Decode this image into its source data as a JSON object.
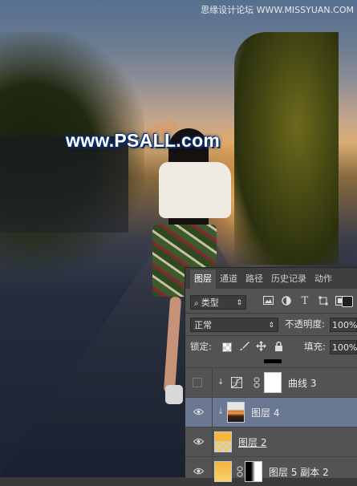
{
  "watermarks": {
    "top": "思缘设计论坛 WWW.MISSYUAN.COM",
    "main": "www.PSALL.com"
  },
  "layers_panel": {
    "tabs": [
      {
        "label": "图层",
        "active": true
      },
      {
        "label": "通道",
        "active": false
      },
      {
        "label": "路径",
        "active": false
      },
      {
        "label": "历史记录",
        "active": false
      },
      {
        "label": "动作",
        "active": false
      }
    ],
    "filter_kind": "类型",
    "filter_icons": [
      "image-filter-icon",
      "adjustment-filter-icon",
      "type-filter-icon",
      "shape-filter-icon",
      "smart-object-filter-icon"
    ],
    "blend_mode": "正常",
    "opacity_label": "不透明度:",
    "opacity_value": "100%",
    "lock_label": "锁定:",
    "lock_icons": [
      "lock-transparent-icon",
      "lock-paint-icon",
      "lock-move-icon",
      "lock-all-icon"
    ],
    "fill_label": "填充:",
    "fill_value": "100%",
    "layers": [
      {
        "name": "曲线 3",
        "visible": false,
        "clipped": true,
        "type": "curves-adjustment",
        "selected": false
      },
      {
        "name": "图层 4",
        "visible": true,
        "clipped": true,
        "type": "image",
        "selected": true
      },
      {
        "name": "图层 2",
        "visible": true,
        "clipped": false,
        "type": "pixel",
        "selected": false
      },
      {
        "name": "图层 5 副本 2",
        "visible": true,
        "clipped": false,
        "type": "pixel-with-mask",
        "selected": false
      }
    ]
  },
  "colors": {
    "panel_bg": "#535353",
    "tab_bar_bg": "#3e3e3e",
    "selected_layer_bg": "#6a7891",
    "watermark_outline": "#0b2f6e"
  }
}
